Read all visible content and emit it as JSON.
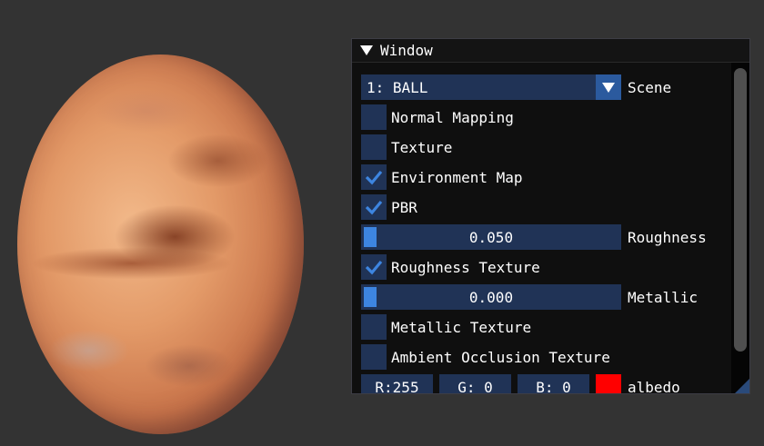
{
  "window": {
    "title": "Window"
  },
  "scene": {
    "value": "1: BALL",
    "label": "Scene"
  },
  "checkboxes": [
    {
      "label": "Normal Mapping",
      "checked": false
    },
    {
      "label": "Texture",
      "checked": false
    },
    {
      "label": "Environment Map",
      "checked": true
    },
    {
      "label": "PBR",
      "checked": true
    }
  ],
  "roughness": {
    "value": "0.050",
    "label": "Roughness",
    "fraction": 0.05
  },
  "roughness_texture": {
    "label": "Roughness Texture",
    "checked": true
  },
  "metallic": {
    "value": "0.000",
    "label": "Metallic",
    "fraction": 0.0
  },
  "metallic_texture": {
    "label": "Metallic Texture",
    "checked": false
  },
  "ao_texture": {
    "label": "Ambient Occlusion Texture",
    "checked": false
  },
  "albedo": {
    "r": "R:255",
    "g": "G:  0",
    "b": "B:  0",
    "label": "albedo",
    "swatch_color": "#ff0000"
  },
  "colors": {
    "accent": "#3d85e0",
    "frame": "#203356",
    "check": "#3d85e0"
  }
}
